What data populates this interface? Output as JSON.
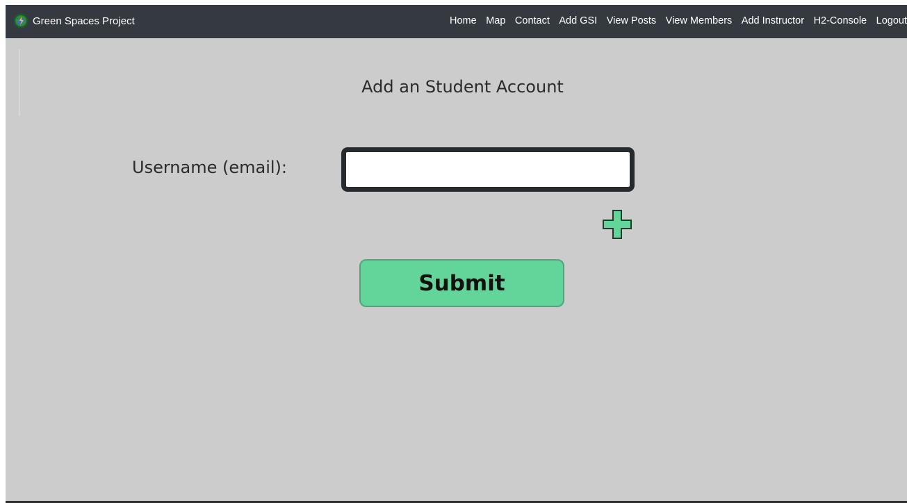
{
  "navbar": {
    "brand": "Green Spaces Project",
    "brand_icon": "globe-logo-icon",
    "links": [
      {
        "label": "Home"
      },
      {
        "label": "Map"
      },
      {
        "label": "Contact"
      },
      {
        "label": "Add GSI"
      },
      {
        "label": "View Posts"
      },
      {
        "label": "View Members"
      },
      {
        "label": "Add Instructor"
      },
      {
        "label": "H2-Console"
      },
      {
        "label": "Logout"
      }
    ]
  },
  "form": {
    "title": "Add an Student Account",
    "username_label": "Username (email):",
    "username_value": "",
    "add_icon": "plus-icon",
    "submit_label": "Submit"
  },
  "colors": {
    "navbar_bg": "#343a40",
    "page_bg": "#cccccc",
    "accent_green": "#63d59a",
    "input_border": "#262b2f"
  }
}
